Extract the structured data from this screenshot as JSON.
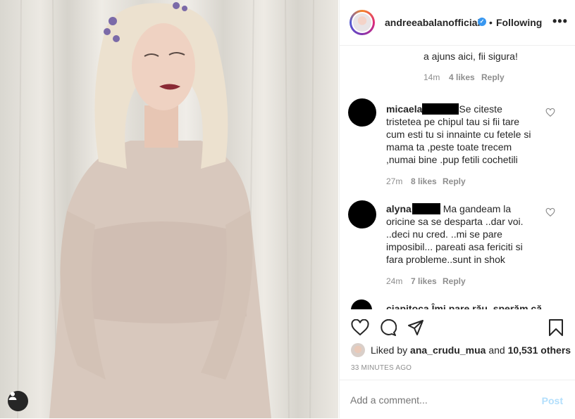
{
  "header": {
    "username": "andreeabalanofficial",
    "separator": "•",
    "follow_status": "Following",
    "more_label": "•••",
    "verified_glyph": "✓"
  },
  "comments": [
    {
      "text_lines": [
        "a ajuns aici, fii sigura!"
      ],
      "age": "14m",
      "likes": "4 likes",
      "reply": "Reply"
    },
    {
      "username": "micaela",
      "text_lines": [
        "Se citeste",
        "tristetea pe chipul tau si fii tare",
        "cum esti tu si innainte cu fetele si",
        "mama ta ,peste toate trecem",
        ",numai bine .pup fetili cochetili"
      ],
      "age": "27m",
      "likes": "8 likes",
      "reply": "Reply"
    },
    {
      "username": "alyna",
      "text_lines": [
        "Ma gandeam la",
        "oricine sa se desparta ..dar voi.",
        "..deci nu cred. ..mi se pare",
        "imposibil... pareati asa fericiti si",
        "fara probleme..sunt in shok"
      ],
      "age": "24m",
      "likes": "7 likes",
      "reply": "Reply"
    },
    {
      "partial_text": "ciapitoca  Îmi pare rău, sperăm că"
    }
  ],
  "likes": {
    "prefix": "Liked by",
    "user": "ana_crudu_mua",
    "and": "and",
    "count": "10,531 others"
  },
  "timestamp": "33 MINUTES AGO",
  "comment_box": {
    "placeholder": "Add a comment...",
    "post_label": "Post"
  },
  "colors": {
    "accent_blue": "#3897f0",
    "post_disabled": "#b2dffc",
    "meta_gray": "#8e8e8e"
  },
  "icons": [
    "heart-icon",
    "comment-icon",
    "share-icon",
    "bookmark-icon",
    "user-tag-icon",
    "verified-icon"
  ]
}
